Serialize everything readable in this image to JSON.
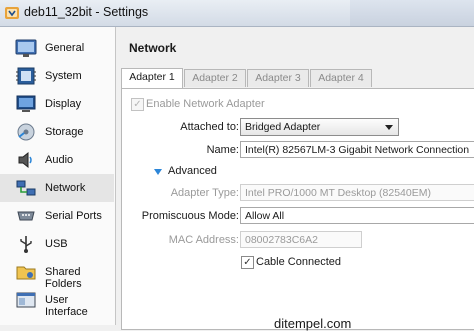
{
  "window": {
    "title": "deb11_32bit - Settings"
  },
  "sidebar": {
    "items": [
      {
        "label": "General",
        "icon": "general-icon"
      },
      {
        "label": "System",
        "icon": "system-icon"
      },
      {
        "label": "Display",
        "icon": "display-icon"
      },
      {
        "label": "Storage",
        "icon": "storage-icon"
      },
      {
        "label": "Audio",
        "icon": "audio-icon"
      },
      {
        "label": "Network",
        "icon": "network-icon",
        "selected": true
      },
      {
        "label": "Serial Ports",
        "icon": "serial-ports-icon"
      },
      {
        "label": "USB",
        "icon": "usb-icon"
      },
      {
        "label": "Shared Folders",
        "icon": "shared-folders-icon"
      },
      {
        "label": "User Interface",
        "icon": "user-interface-icon"
      }
    ]
  },
  "main": {
    "section_title": "Network",
    "tabs": [
      {
        "label": "Adapter 1",
        "active": true
      },
      {
        "label": "Adapter 2"
      },
      {
        "label": "Adapter 3"
      },
      {
        "label": "Adapter 4"
      }
    ],
    "enable_adapter": {
      "label": "Enable Network Adapter",
      "checked": true,
      "disabled": true
    },
    "attached_to": {
      "label": "Attached to:",
      "value": "Bridged Adapter"
    },
    "name": {
      "label": "Name:",
      "value": "Intel(R) 82567LM-3 Gigabit Network Connection"
    },
    "advanced": {
      "label": "Advanced"
    },
    "adapter_type": {
      "label": "Adapter Type:",
      "value": "Intel PRO/1000 MT Desktop (82540EM)"
    },
    "promiscuous": {
      "label": "Promiscuous Mode:",
      "value": "Allow All"
    },
    "mac_address": {
      "label": "MAC Address:",
      "value": "08002783C6A2"
    },
    "cable_connected": {
      "label": "Cable Connected",
      "checked": true
    }
  },
  "watermark": "ditempel.com",
  "colors": {
    "accent": "#2c86d8",
    "selected_bg": "#e5e5e5"
  }
}
